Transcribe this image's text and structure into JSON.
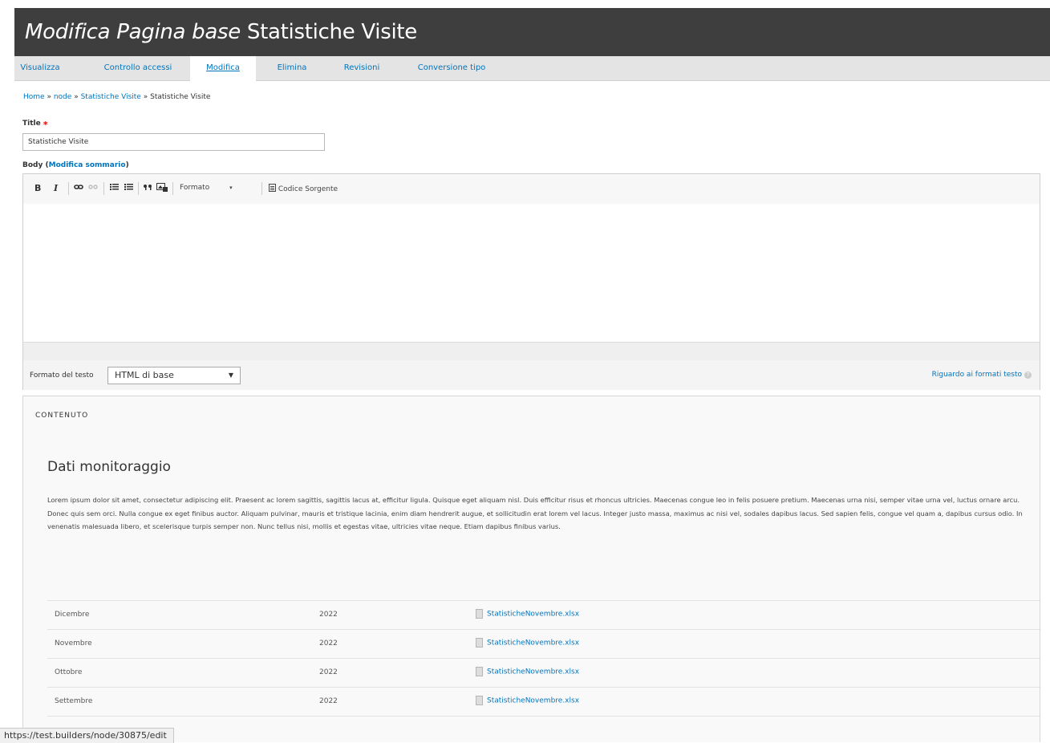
{
  "header": {
    "type_label": "Modifica Pagina base",
    "title": "Statistiche Visite"
  },
  "tabs": [
    {
      "label": "Visualizza"
    },
    {
      "label": "Controllo accessi"
    },
    {
      "label": "Modifica",
      "active": true
    },
    {
      "label": "Elimina"
    },
    {
      "label": "Revisioni"
    },
    {
      "label": "Conversione tipo"
    }
  ],
  "breadcrumb": {
    "home": "Home",
    "sep": "»",
    "node": "node",
    "parent": "Statistiche Visite",
    "current": "Statistiche Visite"
  },
  "form": {
    "title_label": "Title",
    "required_mark": "*",
    "title_value": "Statistiche Visite",
    "body_label": "Body",
    "summary_link": "Modifica sommario",
    "text_format_label": "Formato del testo",
    "text_format_value": "HTML di base",
    "format_help_link": "Riguardo ai formati testo"
  },
  "toolbar": {
    "bold": "B",
    "italic": "I",
    "format_label": "Formato",
    "source_label": "Codice Sorgente"
  },
  "content": {
    "caption": "CONTENUTO",
    "heading": "Dati monitoraggio",
    "paragraph": "Lorem ipsum dolor sit amet, consectetur adipiscing elit. Praesent ac lorem sagittis, sagittis lacus at, efficitur ligula. Quisque eget aliquam nisl. Duis efficitur risus et rhoncus ultricies. Maecenas congue leo in felis posuere pretium. Maecenas urna nisi, semper vitae urna vel, luctus ornare arcu. Donec quis sem orci. Nulla congue ex eget finibus auctor. Aliquam pulvinar, mauris et tristique lacinia, enim diam hendrerit augue, et sollicitudin erat lorem vel lacus. Integer justo massa, maximus ac nisi vel, sodales dapibus lacus. Sed sapien felis, congue vel quam a, dapibus cursus odio. In venenatis malesuada libero, et scelerisque turpis semper non. Nunc tellus nisi, mollis et egestas vitae, ultricies vitae neque. Etiam dapibus finibus varius.",
    "rows": [
      {
        "month": "Dicembre",
        "year": "2022",
        "file": "StatisticheNovembre.xlsx"
      },
      {
        "month": "Novembre",
        "year": "2022",
        "file": "StatisticheNovembre.xlsx"
      },
      {
        "month": "Ottobre",
        "year": "2022",
        "file": "StatisticheNovembre.xlsx"
      },
      {
        "month": "Settembre",
        "year": "2022",
        "file": "StatisticheNovembre.xlsx"
      }
    ]
  },
  "status_url": "https://test.builders/node/30875/edit"
}
